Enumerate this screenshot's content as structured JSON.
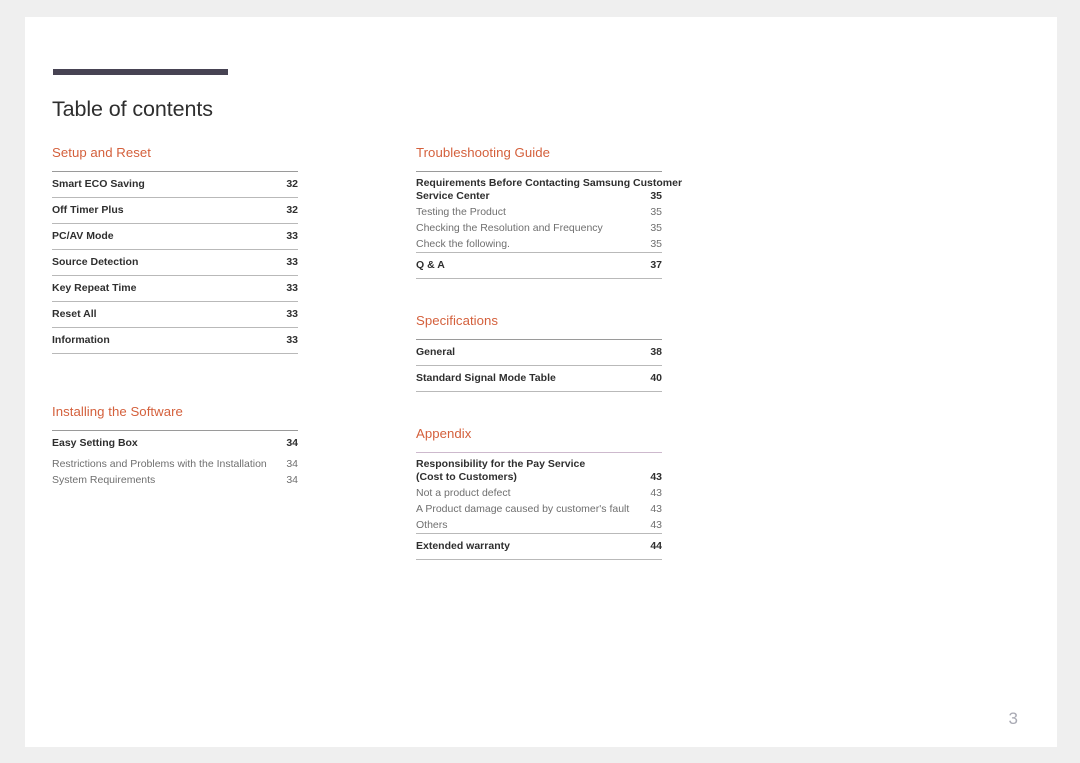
{
  "document": {
    "title": "Table of contents",
    "folio": "3",
    "accent_color": "#d4603c",
    "rule_color": "#474353",
    "page_background": "#ffffff",
    "canvas_background": "#efefef"
  },
  "columns": [
    {
      "name": "left",
      "sections": [
        {
          "heading": "Setup and Reset",
          "rule_tinted": false,
          "entries": [
            {
              "label": "Smart ECO Saving",
              "page": "32",
              "level": 1
            },
            {
              "label": "Off Timer Plus",
              "page": "32",
              "level": 1
            },
            {
              "label": "PC/AV Mode",
              "page": "33",
              "level": 1
            },
            {
              "label": "Source Detection",
              "page": "33",
              "level": 1
            },
            {
              "label": "Key Repeat Time",
              "page": "33",
              "level": 1
            },
            {
              "label": "Reset All",
              "page": "33",
              "level": 1
            },
            {
              "label": "Information",
              "page": "33",
              "level": 1
            }
          ]
        },
        {
          "heading": "Installing the Software",
          "rule_tinted": false,
          "entries": [
            {
              "label": "Easy Setting Box",
              "page": "34",
              "level": 1,
              "no_rule": true
            },
            {
              "label": "Restrictions and Problems with the Installation",
              "page": "34",
              "level": 2
            },
            {
              "label": "System Requirements",
              "page": "34",
              "level": 2
            }
          ]
        }
      ]
    },
    {
      "name": "right",
      "sections": [
        {
          "heading": "Troubleshooting Guide",
          "rule_tinted": false,
          "entries": [
            {
              "label": "Requirements Before Contacting Samsung Customer",
              "label_line2": "Service Center",
              "page": "35",
              "level": 1,
              "wrapped": true
            },
            {
              "label": "Testing the Product",
              "page": "35",
              "level": 2
            },
            {
              "label": "Checking the Resolution and Frequency",
              "page": "35",
              "level": 2
            },
            {
              "label": "Check the following.",
              "page": "35",
              "level": 2
            },
            {
              "label": "Q & A",
              "page": "37",
              "level": 1,
              "rule_above": true
            }
          ]
        },
        {
          "heading": "Specifications",
          "rule_tinted": false,
          "entries": [
            {
              "label": "General",
              "page": "38",
              "level": 1
            },
            {
              "label": "Standard Signal Mode Table",
              "page": "40",
              "level": 1
            }
          ]
        },
        {
          "heading": "Appendix",
          "rule_tinted": true,
          "entries": [
            {
              "label": "Responsibility for the Pay Service",
              "label_line2": "(Cost to Customers)",
              "page": "43",
              "level": 1,
              "wrapped": true
            },
            {
              "label": "Not a product defect",
              "page": "43",
              "level": 2
            },
            {
              "label": "A Product damage caused by customer's fault",
              "page": "43",
              "level": 2
            },
            {
              "label": "Others",
              "page": "43",
              "level": 2
            },
            {
              "label": "Extended warranty",
              "page": "44",
              "level": 1,
              "rule_above": true
            }
          ]
        }
      ]
    }
  ]
}
